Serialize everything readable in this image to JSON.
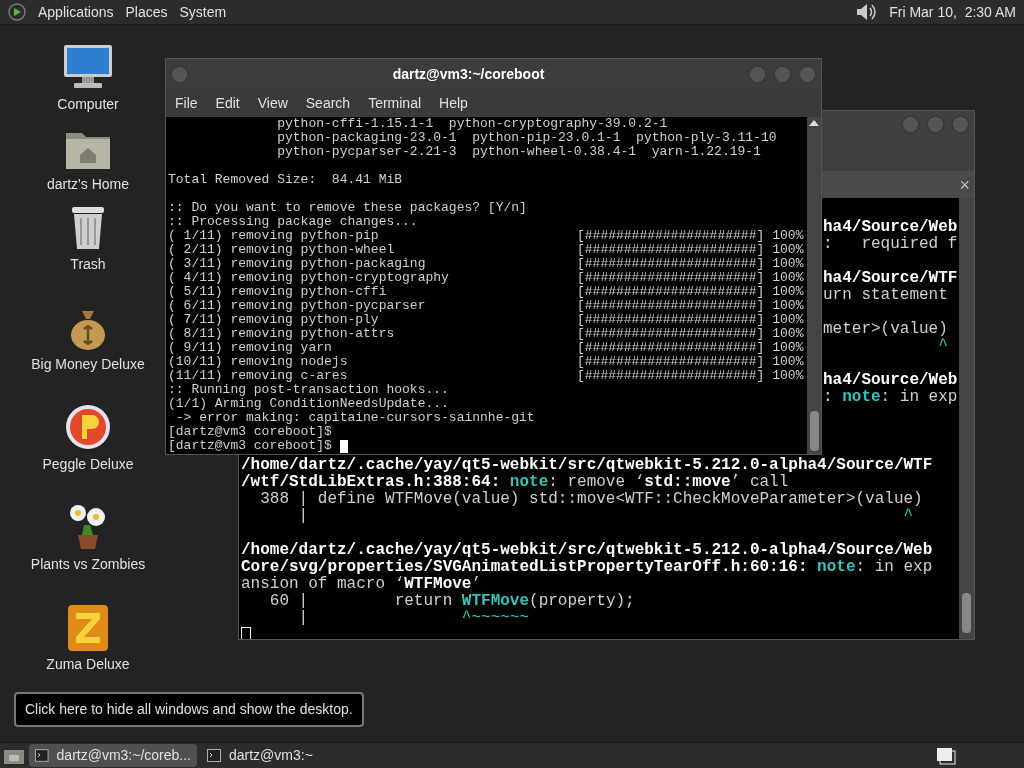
{
  "top_panel": {
    "menus": [
      "Applications",
      "Places",
      "System"
    ],
    "clock": "Fri Mar 10,  2:30 AM"
  },
  "desktop_icons": [
    {
      "kind": "computer",
      "label": "Computer"
    },
    {
      "kind": "home",
      "label": "dartz's Home"
    },
    {
      "kind": "trash",
      "label": "Trash"
    },
    {
      "kind": "money",
      "label": "Big Money Deluxe"
    },
    {
      "kind": "peggle",
      "label": "Peggle Deluxe"
    },
    {
      "kind": "plants",
      "label": "Plants vs Zombies"
    },
    {
      "kind": "zuma",
      "label": "Zuma Deluxe"
    }
  ],
  "back_terminal": {
    "focused": false,
    "tab_close": "×",
    "strip_lines": [
      {
        "kind": "blank"
      },
      {
        "kind": "text",
        "segments": [
          {
            "text": "ha4/Source/Web",
            "kind": "bold"
          }
        ]
      },
      {
        "kind": "text",
        "segments": [
          {
            "text": ":   required f",
            "kind": "plain"
          }
        ]
      },
      {
        "kind": "blank"
      },
      {
        "kind": "text",
        "segments": [
          {
            "text": "ha4/Source/WTF",
            "kind": "bold"
          }
        ]
      },
      {
        "kind": "text",
        "segments": [
          {
            "text": "urn statement",
            "kind": "plain"
          }
        ]
      },
      {
        "kind": "blank"
      },
      {
        "kind": "text",
        "segments": [
          {
            "text": "meter>(value)",
            "kind": "plain"
          }
        ]
      },
      {
        "kind": "text",
        "segments": [
          {
            "text": "            ^",
            "kind": "accent"
          }
        ]
      },
      {
        "kind": "blank"
      },
      {
        "kind": "text",
        "segments": [
          {
            "text": "ha4/Source/Web",
            "kind": "bold"
          }
        ]
      },
      {
        "kind": "text",
        "segments": [
          {
            "text": ": ",
            "kind": "plain"
          },
          {
            "text": "note",
            "kind": "note"
          },
          {
            "text": ": in exp",
            "kind": "plain"
          }
        ]
      },
      {
        "kind": "blank"
      },
      {
        "kind": "blank"
      },
      {
        "kind": "blank"
      }
    ],
    "lines": [
      {
        "kind": "text",
        "segments": [
          {
            "text": "/home/dartz/.cache/yay/qt5-webkit/src/qtwebkit-5.212.0-alpha4/Source/WTF",
            "kind": "bold"
          }
        ]
      },
      {
        "kind": "text",
        "segments": [
          {
            "text": "/wtf/StdLibExtras.h:388:64: ",
            "kind": "bold"
          },
          {
            "text": "note",
            "kind": "note"
          },
          {
            "text": ": remove ‘",
            "kind": "plain"
          },
          {
            "text": "std::move",
            "kind": "bold"
          },
          {
            "text": "’ call",
            "kind": "plain"
          }
        ]
      },
      {
        "kind": "text",
        "segments": [
          {
            "text": "  388 | define WTFMove(value) std::move<WTF::CheckMoveParameter>(value)",
            "kind": "plain"
          }
        ]
      },
      {
        "kind": "text",
        "segments": [
          {
            "text": "      |",
            "kind": "plain"
          },
          {
            "text": "                                                              ^",
            "kind": "accent"
          }
        ]
      },
      {
        "kind": "blank"
      },
      {
        "kind": "text",
        "segments": [
          {
            "text": "/home/dartz/.cache/yay/qt5-webkit/src/qtwebkit-5.212.0-alpha4/Source/Web",
            "kind": "bold"
          }
        ]
      },
      {
        "kind": "text",
        "segments": [
          {
            "text": "Core/svg/properties/SVGAnimatedListPropertyTearOff.h:60:16: ",
            "kind": "bold"
          },
          {
            "text": "note",
            "kind": "note"
          },
          {
            "text": ": in exp",
            "kind": "plain"
          }
        ]
      },
      {
        "kind": "text",
        "segments": [
          {
            "text": "ansion of macro ‘",
            "kind": "plain"
          },
          {
            "text": "WTFMove",
            "kind": "bold"
          },
          {
            "text": "’",
            "kind": "plain"
          }
        ]
      },
      {
        "kind": "text",
        "segments": [
          {
            "text": "   60 |         return ",
            "kind": "plain"
          },
          {
            "text": "WTFMove",
            "kind": "note"
          },
          {
            "text": "(property);",
            "kind": "plain"
          }
        ]
      },
      {
        "kind": "text",
        "segments": [
          {
            "text": "      |",
            "kind": "plain"
          },
          {
            "text": "                ^~~~~~~",
            "kind": "accent"
          }
        ]
      },
      {
        "kind": "cursor"
      }
    ]
  },
  "front_terminal": {
    "title": "dartz@vm3:~/coreboot",
    "focused": true,
    "menu": [
      "File",
      "Edit",
      "View",
      "Search",
      "Terminal",
      "Help"
    ],
    "lines": [
      {
        "kind": "plain",
        "text": "              python-cffi-1.15.1-1  python-cryptography-39.0.2-1"
      },
      {
        "kind": "plain",
        "text": "              python-packaging-23.0-1  python-pip-23.0.1-1  python-ply-3.11-10"
      },
      {
        "kind": "plain",
        "text": "              python-pycparser-2.21-3  python-wheel-0.38.4-1  yarn-1.22.19-1"
      },
      {
        "kind": "blank"
      },
      {
        "kind": "plain",
        "text": "Total Removed Size:  84.41 MiB"
      },
      {
        "kind": "blank"
      },
      {
        "kind": "plain",
        "text": ":: Do you want to remove these packages? [Y/n]"
      },
      {
        "kind": "plain",
        "text": ":: Processing package changes..."
      },
      {
        "kind": "progress",
        "text": "( 1/11) removing python-pip",
        "bar": "[######################]",
        "percent": "100%"
      },
      {
        "kind": "progress",
        "text": "( 2/11) removing python-wheel",
        "bar": "[######################]",
        "percent": "100%"
      },
      {
        "kind": "progress",
        "text": "( 3/11) removing python-packaging",
        "bar": "[######################]",
        "percent": "100%"
      },
      {
        "kind": "progress",
        "text": "( 4/11) removing python-cryptography",
        "bar": "[######################]",
        "percent": "100%"
      },
      {
        "kind": "progress",
        "text": "( 5/11) removing python-cffi",
        "bar": "[######################]",
        "percent": "100%"
      },
      {
        "kind": "progress",
        "text": "( 6/11) removing python-pycparser",
        "bar": "[######################]",
        "percent": "100%"
      },
      {
        "kind": "progress",
        "text": "( 7/11) removing python-ply",
        "bar": "[######################]",
        "percent": "100%"
      },
      {
        "kind": "progress",
        "text": "( 8/11) removing python-attrs",
        "bar": "[######################]",
        "percent": "100%"
      },
      {
        "kind": "progress",
        "text": "( 9/11) removing yarn",
        "bar": "[######################]",
        "percent": "100%"
      },
      {
        "kind": "progress",
        "text": "(10/11) removing nodejs",
        "bar": "[######################]",
        "percent": "100%"
      },
      {
        "kind": "progress",
        "text": "(11/11) removing c-ares",
        "bar": "[######################]",
        "percent": "100%"
      },
      {
        "kind": "plain",
        "text": ":: Running post-transaction hooks..."
      },
      {
        "kind": "plain",
        "text": "(1/1) Arming ConditionNeedsUpdate..."
      },
      {
        "kind": "plain",
        "text": " -> error making: capitaine-cursors-sainnhe-git"
      },
      {
        "kind": "plain",
        "text": "[dartz@vm3 coreboot]$"
      },
      {
        "kind": "prompt",
        "text": "[dartz@vm3 coreboot]$"
      }
    ]
  },
  "tooltip": "Click here to hide all windows and show the desktop.",
  "taskbar": {
    "items": [
      {
        "label": "dartz@vm3:~/coreb...",
        "selected": true
      },
      {
        "label": "dartz@vm3:~",
        "selected": false
      }
    ]
  }
}
